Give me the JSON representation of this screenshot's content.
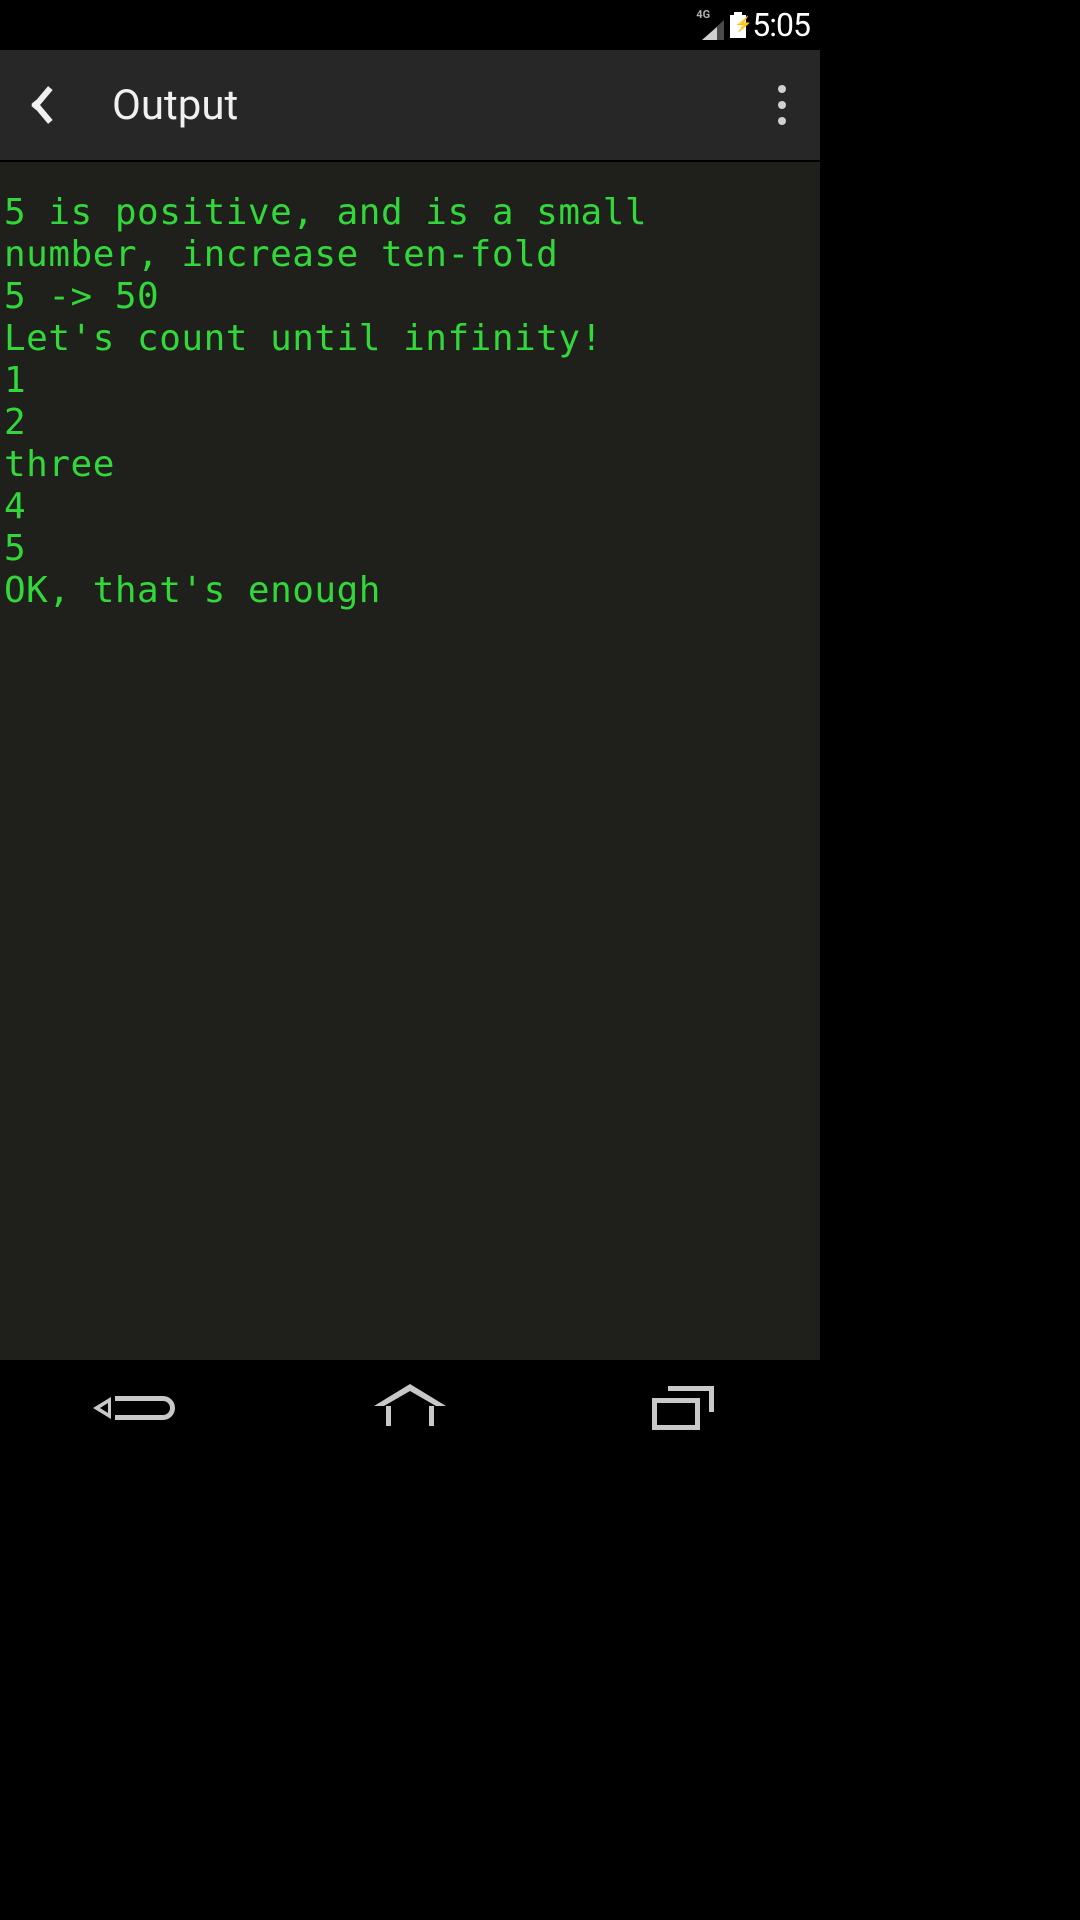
{
  "status": {
    "network": "4G",
    "time": "5:05"
  },
  "header": {
    "title": "Output"
  },
  "console": {
    "lines": [
      "5 is positive, and is a small number, increase ten-fold",
      "5 -> 50",
      "Let's count until infinity!",
      "1",
      "2",
      "three",
      "4",
      "5",
      "OK, that's enough"
    ]
  }
}
